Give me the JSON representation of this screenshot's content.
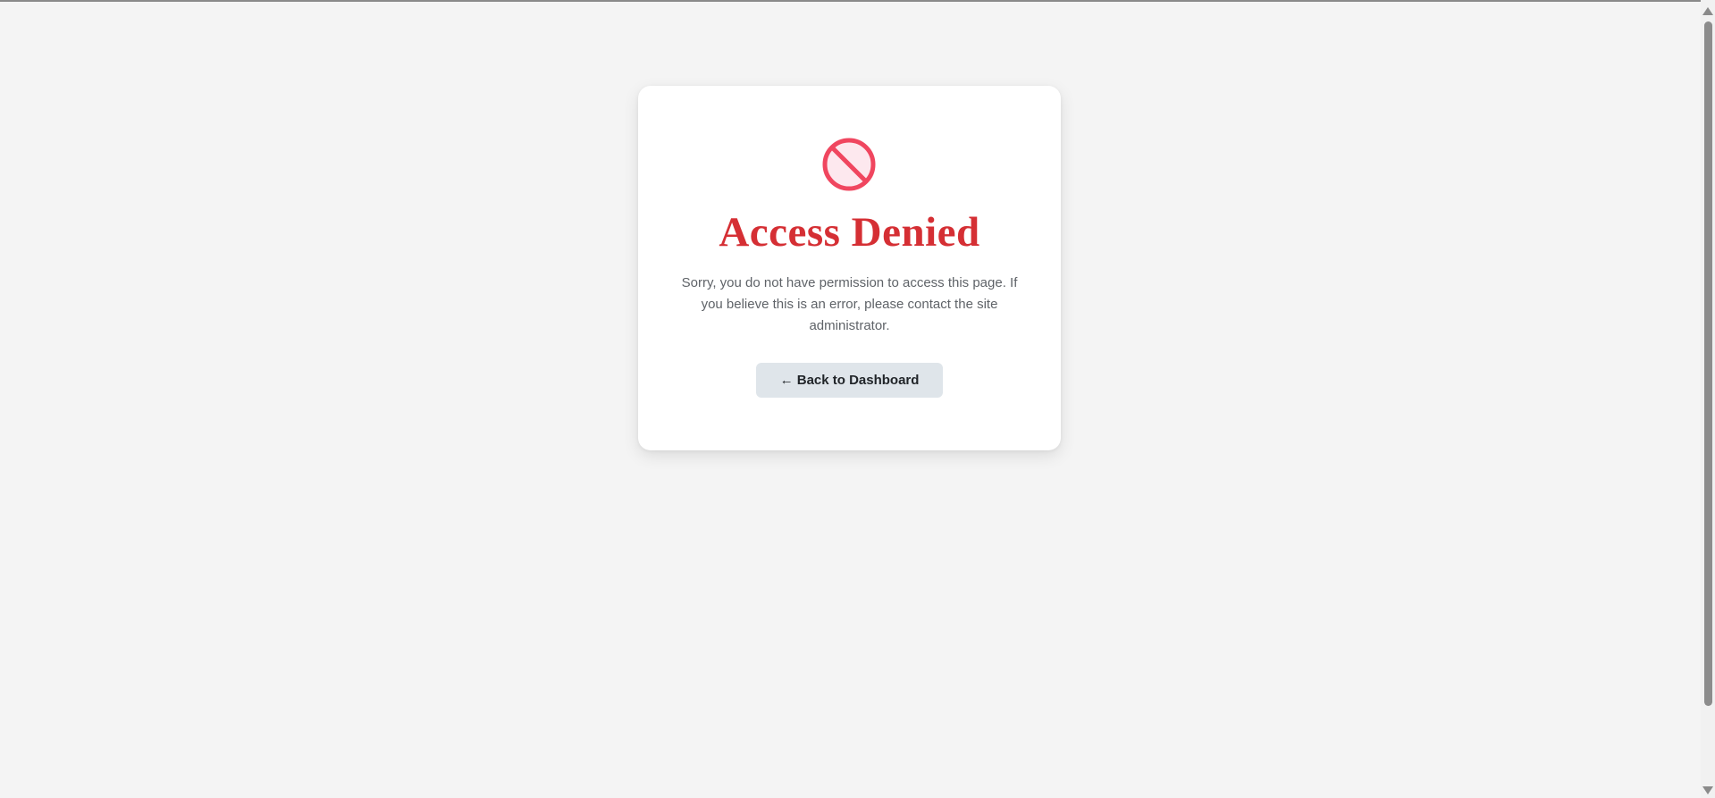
{
  "page": {
    "title": "Access Denied",
    "message": "Sorry, you do not have permission to access this page. If you believe this is an error, please contact the site administrator.",
    "back_button_label": "← Back to Dashboard",
    "icon": "no-entry-icon"
  },
  "colors": {
    "background": "#f4f4f4",
    "card": "#ffffff",
    "title": "#d52f34",
    "icon_stroke": "#f0465f",
    "icon_fill": "#fde8ee",
    "button_bg": "#dfe5ea",
    "message_text": "#5f6368"
  }
}
